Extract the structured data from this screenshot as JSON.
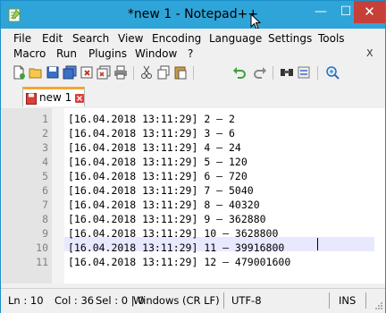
{
  "window": {
    "title": "*new 1 - Notepad++",
    "minimize_glyph": "—",
    "maximize_glyph": "☐",
    "close_glyph": "✕"
  },
  "menu": {
    "row1": [
      "File",
      "Edit",
      "Search",
      "View",
      "Encoding",
      "Language",
      "Settings",
      "Tools"
    ],
    "row2": [
      "Macro",
      "Run",
      "Plugins",
      "Window",
      "?"
    ],
    "close_document": "X"
  },
  "toolbar": {
    "icons": [
      "new-file-icon",
      "open-file-icon",
      "save-icon",
      "save-all-icon",
      "close-icon",
      "close-all-icon",
      "print-icon",
      "cut-icon",
      "copy-icon",
      "paste-icon",
      "undo-icon",
      "redo-icon",
      "find-icon",
      "replace-icon",
      "zoom-in-icon"
    ]
  },
  "tab": {
    "label": "new 1"
  },
  "editor": {
    "lines": [
      {
        "num": "1",
        "text": "[16.04.2018 13:11:29] 2 – 2"
      },
      {
        "num": "2",
        "text": "[16.04.2018 13:11:29] 3 – 6"
      },
      {
        "num": "3",
        "text": "[16.04.2018 13:11:29] 4 – 24"
      },
      {
        "num": "4",
        "text": "[16.04.2018 13:11:29] 5 – 120"
      },
      {
        "num": "5",
        "text": "[16.04.2018 13:11:29] 6 – 720"
      },
      {
        "num": "6",
        "text": "[16.04.2018 13:11:29] 7 – 5040"
      },
      {
        "num": "7",
        "text": "[16.04.2018 13:11:29] 8 – 40320"
      },
      {
        "num": "8",
        "text": "[16.04.2018 13:11:29] 9 – 362880"
      },
      {
        "num": "9",
        "text": "[16.04.2018 13:11:29] 10 – 3628800"
      },
      {
        "num": "10",
        "text": "[16.04.2018 13:11:29] 11 – 39916800"
      },
      {
        "num": "11",
        "text": "[16.04.2018 13:11:29] 12 – 479001600"
      }
    ],
    "current_line": 10
  },
  "status": {
    "ln": "Ln : 10",
    "col": "Col : 36",
    "sel": "Sel : 0 | 0",
    "eol": "Windows (CR LF)",
    "encoding": "UTF-8",
    "mode": "INS"
  },
  "colors": {
    "titlebar": "#2fa4d8",
    "close_button": "#c6403a",
    "tab_accent": "#f6a534",
    "current_line": "#e8e8ff"
  }
}
